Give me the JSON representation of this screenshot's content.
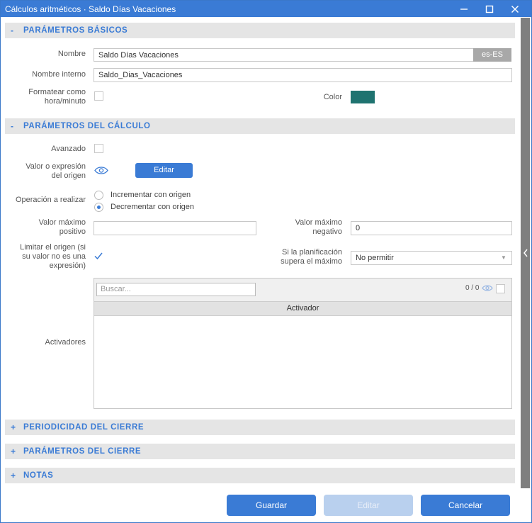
{
  "window": {
    "title": "Cálculos aritméticos · Saldo Días Vacaciones"
  },
  "sections": {
    "basic": {
      "sign": "-",
      "title": "PARÁMETROS BÁSICOS"
    },
    "calc": {
      "sign": "-",
      "title": "PARÁMETROS DEL CÁLCULO"
    },
    "periodicidad": {
      "sign": "+",
      "title": "PERIODICIDAD DEL CIERRE"
    },
    "cierre": {
      "sign": "+",
      "title": "PARÁMETROS DEL CIERRE"
    },
    "notas": {
      "sign": "+",
      "title": "NOTAS"
    }
  },
  "basic": {
    "nombre_label": "Nombre",
    "nombre_value": "Saldo Días Vacaciones",
    "lang": "es-ES",
    "nombre_interno_label": "Nombre interno",
    "nombre_interno_value": "Saldo_Dias_Vacaciones",
    "formatear_label_1": "Formatear como",
    "formatear_label_2": "hora/minuto",
    "formatear_checked": false,
    "color_label": "Color",
    "color_value": "#1f7370"
  },
  "calc": {
    "avanzado_label": "Avanzado",
    "avanzado_checked": false,
    "valor_label_1": "Valor o expresión",
    "valor_label_2": "del origen",
    "editar_label": "Editar",
    "operacion_label": "Operación a realizar",
    "options": [
      "Incrementar con origen",
      "Decrementar con origen"
    ],
    "selected_option": "Decrementar con origen",
    "max_pos_label_1": "Valor máximo",
    "max_pos_label_2": "positivo",
    "max_pos_value": "",
    "max_neg_label_1": "Valor máximo",
    "max_neg_label_2": "negativo",
    "max_neg_value": "0",
    "limitar_label_1": "Limitar el origen (si",
    "limitar_label_2": "su valor no es una",
    "limitar_label_3": "expresión)",
    "limitar_checked": true,
    "planif_label_1": "Si la planificación",
    "planif_label_2": "supera el máximo",
    "planif_value": "No permitir",
    "activadores_label": "Activadores",
    "grid": {
      "search_placeholder": "Buscar...",
      "count": "0 / 0",
      "column": "Activador",
      "rows": []
    }
  },
  "footer": {
    "guardar": "Guardar",
    "editar": "Editar",
    "cancelar": "Cancelar"
  },
  "colors": {
    "accent": "#3a7bd5",
    "section_bg": "#e5e5e5",
    "swatch": "#1f7370"
  }
}
